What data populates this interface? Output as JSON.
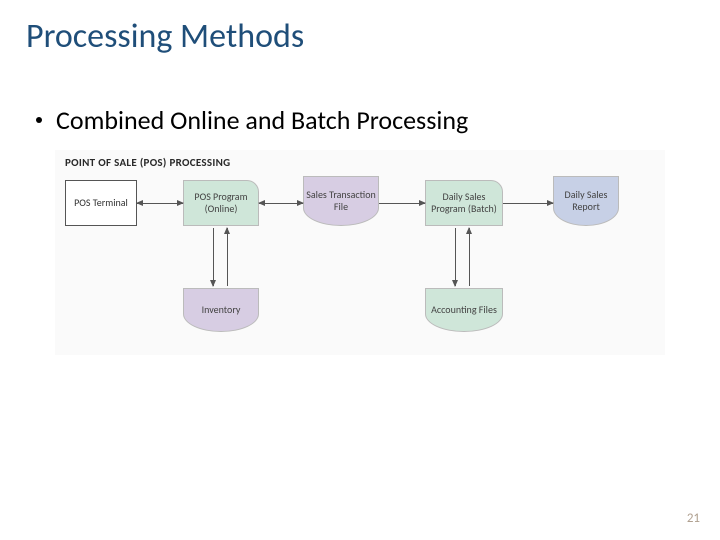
{
  "title": "Processing Methods",
  "bullet": "Combined Online and Batch Processing",
  "diagram": {
    "heading": "POINT OF SALE (POS) PROCESSING",
    "nodes": {
      "pos_terminal": "POS\nTerminal",
      "pos_program": "POS\nProgram\n(Online)",
      "sales_file": "Sales\nTransaction\nFile",
      "daily_sales_prog": "Daily Sales\nProgram\n(Batch)",
      "daily_report": "Daily\nSales\nReport",
      "inventory": "Inventory",
      "accounting": "Accounting\nFiles"
    }
  },
  "page_number": "21"
}
